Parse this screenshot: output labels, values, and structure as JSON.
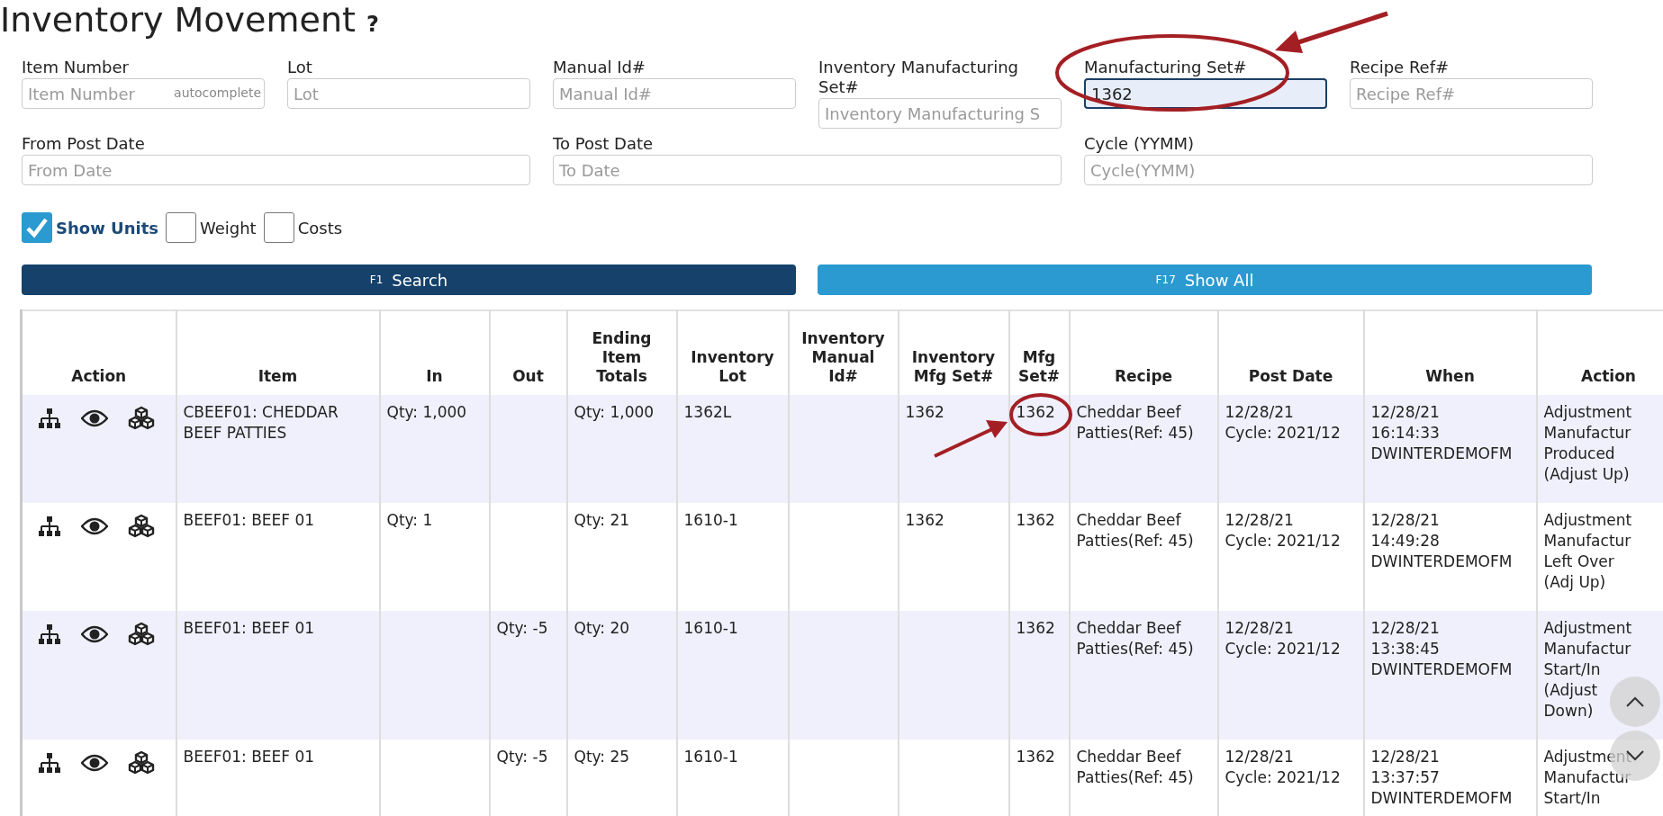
{
  "title": "Inventory Movement",
  "help": "?",
  "filter_rows": [
    [
      {
        "label": "Item Number",
        "placeholder": "Item Number",
        "hint": "autocomplete",
        "focused": false
      },
      {
        "label": "Lot",
        "placeholder": "Lot",
        "focused": false
      },
      {
        "label": "Manual Id#",
        "placeholder": "Manual Id#",
        "focused": false
      },
      {
        "label": "Inventory Manufacturing Set#",
        "placeholder": "Inventory Manufacturing S",
        "focused": false
      },
      {
        "label": "Manufacturing Set#",
        "value": "1362",
        "focused": true,
        "circled": true
      },
      {
        "label": "Recipe Ref#",
        "placeholder": "Recipe Ref#",
        "focused": false
      }
    ],
    [
      {
        "label": "From Post Date",
        "placeholder": "From Date",
        "focused": false
      },
      {
        "label": "To Post Date",
        "placeholder": "To Date",
        "focused": false
      },
      {
        "label": "Cycle (YYMM)",
        "placeholder": "Cycle(YYMM)",
        "focused": false
      }
    ]
  ],
  "checkboxes": [
    {
      "label": "Show Units",
      "checked": true
    },
    {
      "label": "Weight",
      "checked": false
    },
    {
      "label": "Costs",
      "checked": false
    }
  ],
  "buttons": [
    {
      "key": "F1",
      "label": "Search",
      "kind": "primary"
    },
    {
      "key": "F17",
      "label": "Show All",
      "kind": "secondary"
    }
  ],
  "table": {
    "columns": [
      "Action",
      "Item",
      "In",
      "Out",
      "Ending\nItem\nTotals",
      "Inventory\nLot",
      "Inventory\nManual\nId#",
      "Inventory\nMfg Set#",
      "Mfg\nSet#",
      "Recipe",
      "Post Date",
      "When",
      "Action"
    ],
    "rows": [
      {
        "cells": [
          null,
          "CBEEF01: CHEDDAR BEEF PATTIES",
          "Qty: 1,000",
          null,
          "Qty: 1,000",
          "1362L",
          null,
          "1362",
          {
            "text": "1362",
            "circled": true
          },
          "Cheddar Beef Patties(Ref: 45)",
          "12/28/21\nCycle: 2021/12",
          "12/28/21\n16:14:33\nDWINTERDEMOFM",
          "Adjustment\nManufactur\nProduced\n(Adjust Up)"
        ]
      },
      {
        "cells": [
          null,
          "BEEF01: BEEF 01",
          "Qty: 1",
          null,
          "Qty: 21",
          "1610-1",
          null,
          "1362",
          "1362",
          "Cheddar Beef Patties(Ref: 45)",
          "12/28/21\nCycle: 2021/12",
          "12/28/21\n14:49:28\nDWINTERDEMOFM",
          "Adjustment\nManufactur\nLeft Over\n(Adj Up)"
        ]
      },
      {
        "cells": [
          null,
          "BEEF01: BEEF 01",
          null,
          "Qty: -5",
          "Qty: 20",
          "1610-1",
          null,
          null,
          "1362",
          "Cheddar Beef Patties(Ref: 45)",
          "12/28/21\nCycle: 2021/12",
          "12/28/21\n13:38:45\nDWINTERDEMOFM",
          "Adjustment\nManufactur\nStart/In\n(Adjust\nDown)"
        ]
      },
      {
        "cells": [
          null,
          "BEEF01: BEEF 01",
          null,
          "Qty: -5",
          "Qty: 25",
          "1610-1",
          null,
          null,
          "1362",
          "Cheddar Beef Patties(Ref: 45)",
          "12/28/21\nCycle: 2021/12",
          "12/28/21\n13:37:57\nDWINTERDEMOFM",
          "Adjustment\nManufactur\nStart/In"
        ]
      }
    ]
  }
}
